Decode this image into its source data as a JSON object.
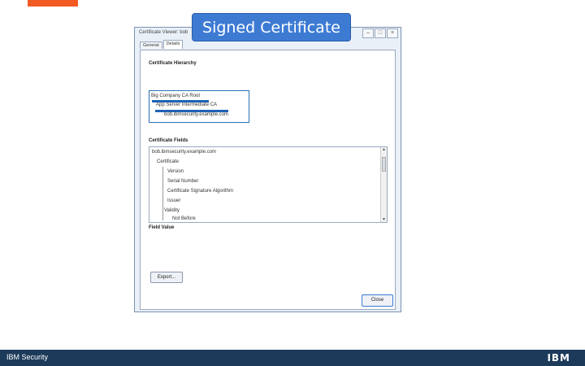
{
  "slide": {
    "title": "Signed Certificate"
  },
  "dialog": {
    "title": "Certificate Viewer: bob",
    "window_buttons": [
      "–",
      "□",
      "×"
    ],
    "tabs": [
      "General",
      "Details"
    ],
    "active_tab": "Details",
    "hierarchy_label": "Certificate Hierarchy",
    "hierarchy": [
      "Big Company CA Root",
      "App Server Intermediate CA",
      "bob.ibmsecurity.example.com"
    ],
    "fields_label": "Certificate Fields",
    "fields": [
      "bob.ibmsecurity.example.com",
      "Certificate",
      "Version",
      "Serial Number",
      "Certificate Signature Algorithm",
      "Issuer",
      "Validity",
      "Not Before"
    ],
    "value_label": "Field Value",
    "export_label": "Export...",
    "close_label": "Close"
  },
  "footer": {
    "brand": "IBM Security",
    "logo": "IBM"
  },
  "colors": {
    "accent": "#f15a22",
    "title_bg": "#3d7bd3",
    "footer_bg": "#1c3a5a",
    "selection": "#1f64b5"
  }
}
